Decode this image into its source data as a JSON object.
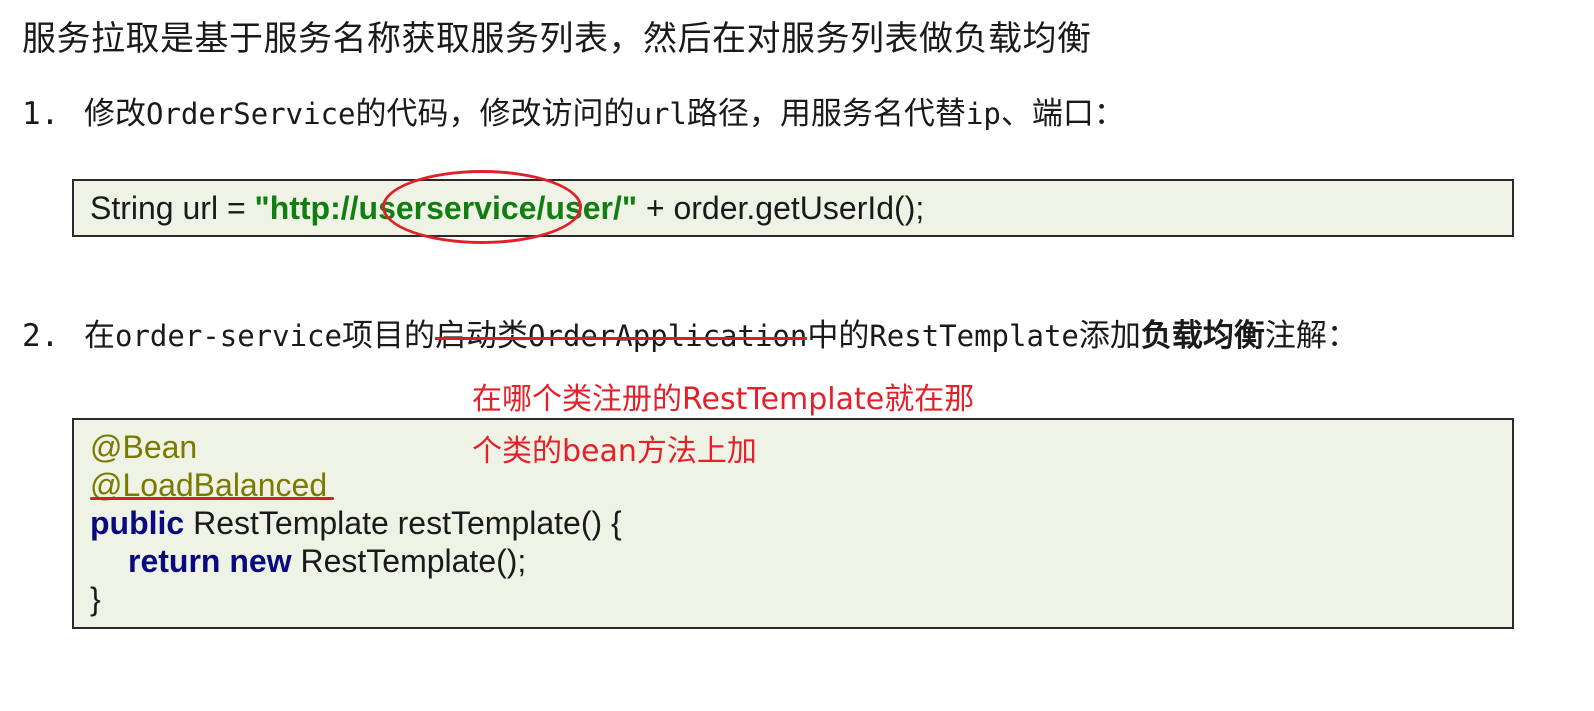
{
  "intro": "服务拉取是基于服务名称获取服务列表，然后在对服务列表做负载均衡",
  "step1": {
    "number": "1.",
    "text_a": "修改",
    "text_b": "OrderService",
    "text_c": "的代码，修改访问的",
    "text_d": "url",
    "text_e": "路径，用服务名代替",
    "text_f": "ip",
    "text_g": "、端口："
  },
  "code1": {
    "prefix": "String url = ",
    "string": "\"http://userservice/user/\"",
    "suffix": " + order.getUserId();"
  },
  "step2": {
    "number": "2.",
    "text_a": "在",
    "text_b": "order-service",
    "text_c": "项目的",
    "strike_a": "启动类",
    "strike_b": "OrderApplication",
    "text_d": "中的",
    "text_e": "RestTemplate",
    "text_f": "添加",
    "text_bold": "负载均衡",
    "text_g": "注解："
  },
  "note": {
    "line1": "在哪个类注册的RestTemplate就在那",
    "line2": "个类的bean方法上加"
  },
  "code2": {
    "line1": "@Bean",
    "line2": "@LoadBalanced",
    "line3_kw": "public",
    "line3_rest": " RestTemplate restTemplate() {",
    "line4_kw1": "return",
    "line4_kw2": "new",
    "line4_rest": " RestTemplate();",
    "line5": "}"
  },
  "colors": {
    "string": "#127d12",
    "annotation": "#7a7a00",
    "keyword": "#0a0a80",
    "markup_red": "#e0202a",
    "code_bg": "#eef3e5"
  }
}
